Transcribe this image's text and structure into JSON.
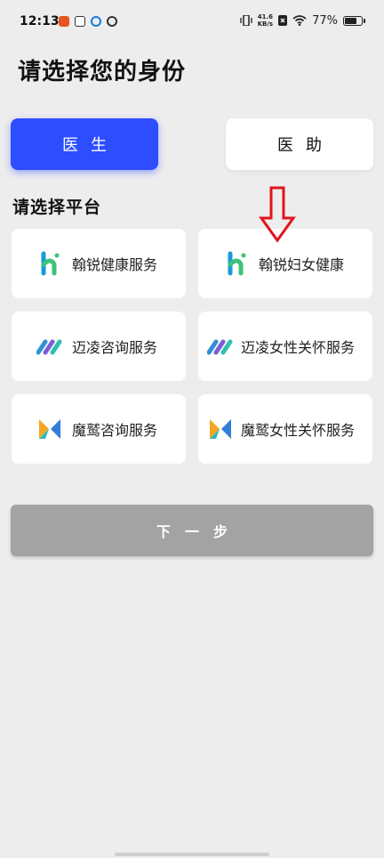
{
  "status_bar": {
    "time": "12:13",
    "net_speed_value": "41.6",
    "net_speed_unit": "KB/s",
    "battery_percent": "77%",
    "battery_level": 0.77
  },
  "page": {
    "title": "请选择您的身份"
  },
  "roles": {
    "doctor": "医生",
    "assistant": "医助",
    "selected": "doctor",
    "selected_color": "#2e4dff"
  },
  "platform_section": {
    "title": "请选择平台",
    "platforms": [
      {
        "label": "翰锐健康服务",
        "icon": "hanrui-logo-icon"
      },
      {
        "label": "翰锐妇女健康",
        "icon": "hanrui-logo-icon"
      },
      {
        "label": "迈凌咨询服务",
        "icon": "mailing-logo-icon"
      },
      {
        "label": "迈凌女性关怀服务",
        "icon": "mailing-logo-icon"
      },
      {
        "label": "魔鹫咨询服务",
        "icon": "mojiu-logo-icon"
      },
      {
        "label": "魔鹫女性关怀服务",
        "icon": "mojiu-logo-icon"
      }
    ]
  },
  "annotation": {
    "icon": "down-arrow-icon",
    "color": "#e0141e"
  },
  "next_button": {
    "label": "下一步",
    "color": "#a3a3a3"
  }
}
